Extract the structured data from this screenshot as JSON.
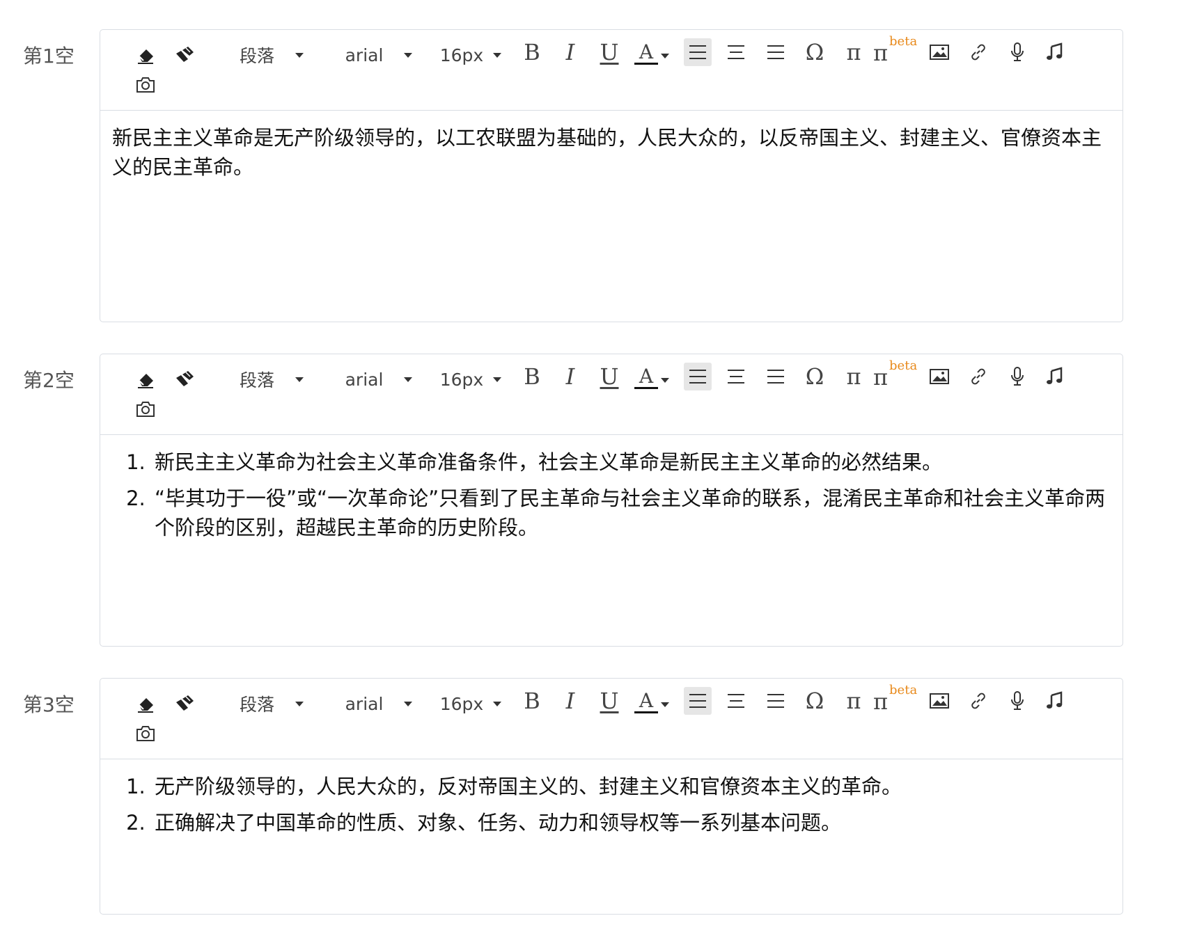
{
  "toolbar": {
    "paragraph_label": "段落",
    "font_label": "arial",
    "size_label": "16px",
    "bold": "B",
    "italic": "I",
    "underline": "U",
    "color": "A",
    "omega": "Ω",
    "pi": "π",
    "pi_beta": "π",
    "beta": "beta",
    "beta_color": "#e8891a"
  },
  "blanks": [
    {
      "label": "第1空",
      "paragraph": "新民主主义革命是无产阶级领导的，以工农联盟为基础的，人民大众的，以反帝国主义、封建主义、官僚资本主义的民主革命。"
    },
    {
      "label": "第2空",
      "items": [
        "新民主主义革命为社会主义革命准备条件，社会主义革命是新民主主义革命的必然结果。",
        "“毕其功于一役”或“一次革命论”只看到了民主革命与社会主义革命的联系，混淆民主革命和社会主义革命两个阶段的区别，超越民主革命的历史阶段。"
      ]
    },
    {
      "label": "第3空",
      "items": [
        "无产阶级领导的，人民大众的，反对帝国主义的、封建主义和官僚资本主义的革命。",
        "正确解决了中国革命的性质、对象、任务、动力和领导权等一系列基本问题。"
      ]
    }
  ]
}
